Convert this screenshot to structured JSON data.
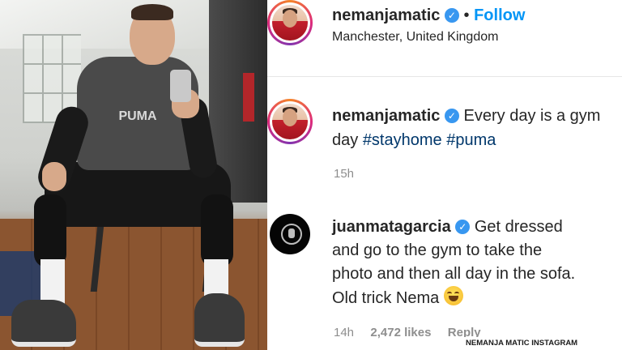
{
  "header": {
    "username": "nemanjamatic",
    "verified_icon": "verified-badge-icon",
    "separator": "•",
    "follow_label": "Follow",
    "location": "Manchester, United Kingdom"
  },
  "post": {
    "username": "nemanjamatic",
    "caption_line1": "Every day is a gym",
    "caption_line2_prefix": "day",
    "hashtags": [
      "#stayhome",
      "#puma"
    ],
    "time": "15h"
  },
  "comment": {
    "username": "juanmatagarcia",
    "line1": "Get dressed",
    "line2": "and go to the gym to take the",
    "line3": "photo and then all day in the sofa.",
    "line4": "Old trick Nema",
    "emoji_icon": "laughing-emoji-icon",
    "time": "14h",
    "likes": "2,472 likes",
    "reply_label": "Reply"
  },
  "photo": {
    "shirt_text": "PUMA"
  },
  "watermark": "NEMANJA MATIC INSTAGRAM",
  "colors": {
    "follow_blue": "#0095f6",
    "hashtag_blue": "#00376b",
    "verified_blue": "#3897f0",
    "muted_gray": "#8e8e8e"
  }
}
